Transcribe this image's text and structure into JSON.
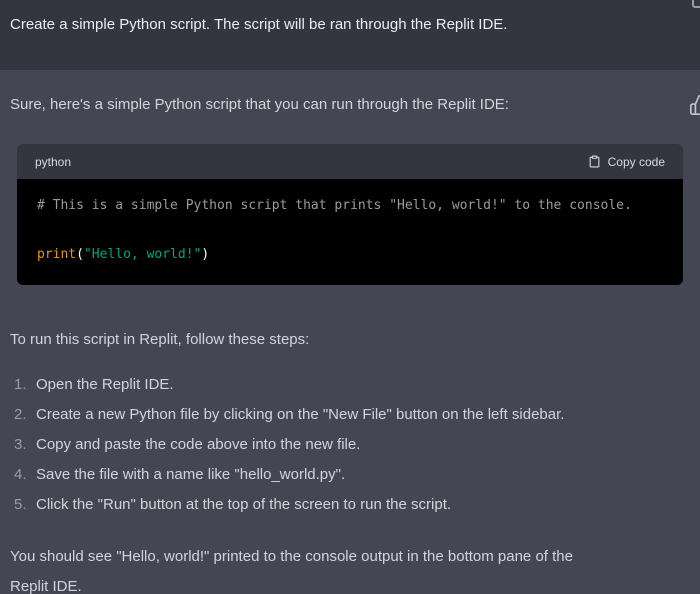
{
  "user_message": "Create a simple Python script. The script will be ran through the Replit IDE.",
  "assistant": {
    "intro": "Sure, here's a simple Python script that you can run through the Replit IDE:",
    "code_block": {
      "language_label": "python",
      "copy_button_label": "Copy code",
      "comment_line": "# This is a simple Python script that prints \"Hello, world!\" to the console.",
      "code_line": {
        "function": "print",
        "open_paren": "(",
        "string": "\"Hello, world!\"",
        "close_paren": ")"
      }
    },
    "steps_intro": "To run this script in Replit, follow these steps:",
    "steps": [
      {
        "num": "1.",
        "text": "Open the Replit IDE."
      },
      {
        "num": "2.",
        "text": "Create a new Python file by clicking on the \"New File\" button on the left sidebar."
      },
      {
        "num": "3.",
        "text": "Copy and paste the code above into the new file."
      },
      {
        "num": "4.",
        "text": "Save the file with a name like \"hello_world.py\"."
      },
      {
        "num": "5.",
        "text": "Click the \"Run\" button at the top of the screen to run the script."
      }
    ],
    "outro_line1": "You should see \"Hello, world!\" printed to the console output in the bottom pane of the",
    "outro_line2": "Replit IDE."
  },
  "icons": {
    "copy": "clipboard-icon",
    "feedback": "thumbs-up-icon",
    "corner": "edit-icon"
  },
  "colors": {
    "user_row_bg": "#343541",
    "assistant_row_bg": "#444654",
    "code_header_bg": "#343541",
    "code_bg": "#000000",
    "user_text": "#ececf1",
    "assistant_text": "#d1d5db",
    "code_comment": "#9b9b9b",
    "code_builtin": "#e9950c",
    "code_string": "#00a67d"
  }
}
